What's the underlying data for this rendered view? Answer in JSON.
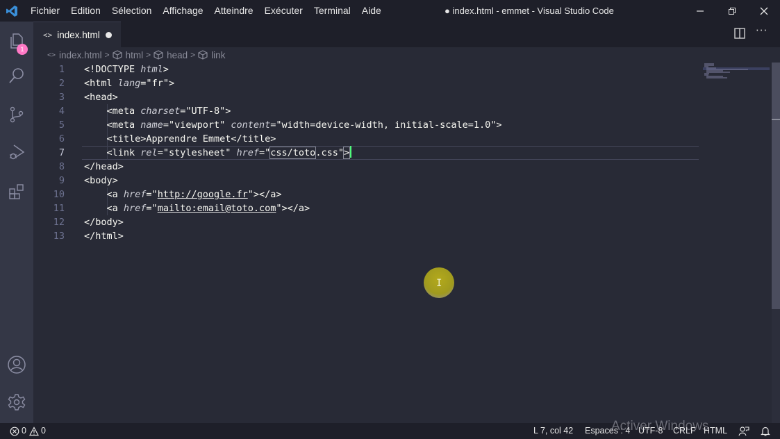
{
  "titlebar": {
    "app_icon": "vscode-logo-icon",
    "menu": [
      "Fichier",
      "Edition",
      "Sélection",
      "Affichage",
      "Atteindre",
      "Exécuter",
      "Terminal",
      "Aide"
    ],
    "window_title": "● index.html - emmet - Visual Studio Code",
    "controls": [
      "minimize-icon",
      "restore-icon",
      "close-icon"
    ]
  },
  "activitybar": {
    "items": [
      {
        "name": "explorer",
        "icon": "files-icon",
        "badge": "1"
      },
      {
        "name": "search",
        "icon": "search-icon"
      },
      {
        "name": "source-control",
        "icon": "source-control-icon"
      },
      {
        "name": "run-debug",
        "icon": "run-debug-icon"
      },
      {
        "name": "extensions",
        "icon": "extensions-icon"
      }
    ],
    "bottom": [
      {
        "name": "accounts",
        "icon": "account-icon"
      },
      {
        "name": "manage",
        "icon": "gear-icon"
      }
    ]
  },
  "tabs": [
    {
      "label": "index.html",
      "icon": "<>",
      "dirty": true,
      "active": true
    }
  ],
  "editor_actions": {
    "split": "split-editor-icon",
    "more": "···"
  },
  "breadcrumb": [
    "index.html",
    "html",
    "head",
    "link"
  ],
  "editor": {
    "active_line": 7,
    "lines": [
      {
        "n": "1",
        "indent": "",
        "parts": [
          [
            "t",
            "<!DOCTYPE "
          ],
          [
            "a",
            "html"
          ],
          [
            "t",
            ">"
          ]
        ]
      },
      {
        "n": "2",
        "indent": "",
        "parts": [
          [
            "t",
            "<html "
          ],
          [
            "a",
            "lang"
          ],
          [
            "t",
            "=\""
          ],
          [
            "s",
            "fr"
          ],
          [
            "t",
            "\">"
          ]
        ]
      },
      {
        "n": "3",
        "indent": "",
        "parts": [
          [
            "t",
            "<head>"
          ]
        ]
      },
      {
        "n": "4",
        "indent": "    ",
        "parts": [
          [
            "t",
            "<meta "
          ],
          [
            "a",
            "charset"
          ],
          [
            "t",
            "=\""
          ],
          [
            "s",
            "UTF-8"
          ],
          [
            "t",
            "\">"
          ]
        ]
      },
      {
        "n": "5",
        "indent": "    ",
        "parts": [
          [
            "t",
            "<meta "
          ],
          [
            "a",
            "name"
          ],
          [
            "t",
            "=\""
          ],
          [
            "s",
            "viewport"
          ],
          [
            "t",
            "\" "
          ],
          [
            "a",
            "content"
          ],
          [
            "t",
            "=\""
          ],
          [
            "s",
            "width=device-width, initial-scale=1.0"
          ],
          [
            "t",
            "\">"
          ]
        ]
      },
      {
        "n": "6",
        "indent": "    ",
        "parts": [
          [
            "t",
            "<title>"
          ],
          [
            "s",
            "Apprendre Emmet"
          ],
          [
            "t",
            "</title>"
          ]
        ]
      },
      {
        "n": "7",
        "indent": "    ",
        "parts": [
          [
            "t",
            "<link "
          ],
          [
            "a",
            "rel"
          ],
          [
            "t",
            "=\""
          ],
          [
            "s",
            "stylesheet"
          ],
          [
            "t",
            "\" "
          ],
          [
            "a",
            "href"
          ],
          [
            "t",
            "=\""
          ],
          [
            "sel",
            "css/toto"
          ],
          [
            "s",
            ".css"
          ],
          [
            "t",
            "\""
          ],
          [
            "box",
            ">"
          ],
          [
            "cursor",
            ""
          ]
        ]
      },
      {
        "n": "8",
        "indent": "",
        "parts": [
          [
            "t",
            "</head>"
          ]
        ]
      },
      {
        "n": "9",
        "indent": "",
        "parts": [
          [
            "t",
            "<body>"
          ]
        ]
      },
      {
        "n": "10",
        "indent": "    ",
        "parts": [
          [
            "t",
            "<a "
          ],
          [
            "a",
            "href"
          ],
          [
            "t",
            "=\""
          ],
          [
            "u",
            "http://google.fr"
          ],
          [
            "t",
            "\"></a>"
          ]
        ]
      },
      {
        "n": "11",
        "indent": "    ",
        "parts": [
          [
            "t",
            "<a "
          ],
          [
            "a",
            "href"
          ],
          [
            "t",
            "=\""
          ],
          [
            "u",
            "mailto:email@toto.com"
          ],
          [
            "t",
            "\"></a>"
          ]
        ]
      },
      {
        "n": "12",
        "indent": "",
        "parts": [
          [
            "t",
            "</body>"
          ]
        ]
      },
      {
        "n": "13",
        "indent": "",
        "parts": [
          [
            "t",
            "</html>"
          ]
        ]
      }
    ]
  },
  "statusbar": {
    "errors": "0",
    "warnings": "0",
    "position": "L 7, col 42",
    "indent": "Espaces : 4",
    "encoding": "UTF-8",
    "eol": "CRLF",
    "language": "HTML",
    "feedback_icon": "feedback-icon",
    "notifications_icon": "bell-icon"
  },
  "watermark": "Activer Windows",
  "colors": {
    "background": "#282a36",
    "titlebar": "#1e1f29",
    "activitybar": "#343746",
    "badge": "#ff79c6",
    "cursor": "#50fa7b"
  }
}
